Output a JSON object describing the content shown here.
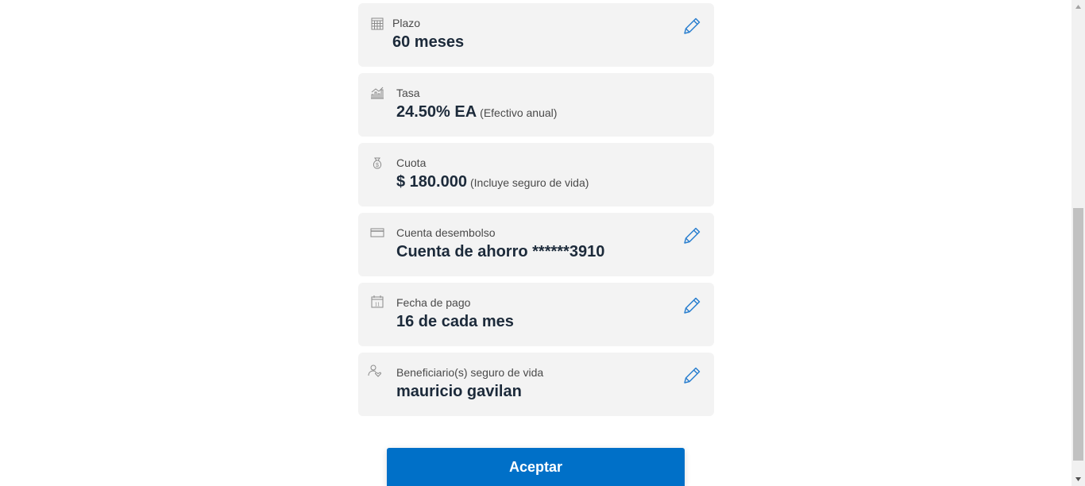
{
  "cards": [
    {
      "label": "Plazo",
      "value": "60 meses",
      "note": "",
      "icon": "calendar-grid-icon",
      "editable": true
    },
    {
      "label": "Tasa",
      "value": "24.50% EA",
      "note": "(Efectivo anual)",
      "icon": "chart-icon",
      "editable": false
    },
    {
      "label": "Cuota",
      "value": "$ 180.000",
      "note": "(Incluye seguro de vida)",
      "icon": "money-bag-icon",
      "editable": false
    },
    {
      "label": "Cuenta desembolso",
      "value": "Cuenta de ahorro ******3910",
      "note": "",
      "icon": "card-icon",
      "editable": true
    },
    {
      "label": "Fecha de pago",
      "value": "16 de cada mes",
      "note": "",
      "icon": "calendar-day-icon",
      "editable": true
    },
    {
      "label": "Beneficiario(s) seguro de vida",
      "value": "mauricio gavilan",
      "note": "",
      "icon": "person-heart-icon",
      "editable": true
    }
  ],
  "calendar_day": "11",
  "accept_button": "Aceptar",
  "colors": {
    "card_bg": "#f3f3f3",
    "value_text": "#1c2a3a",
    "edit_icon": "#2a7fcf",
    "accent_button": "#0070c8"
  }
}
